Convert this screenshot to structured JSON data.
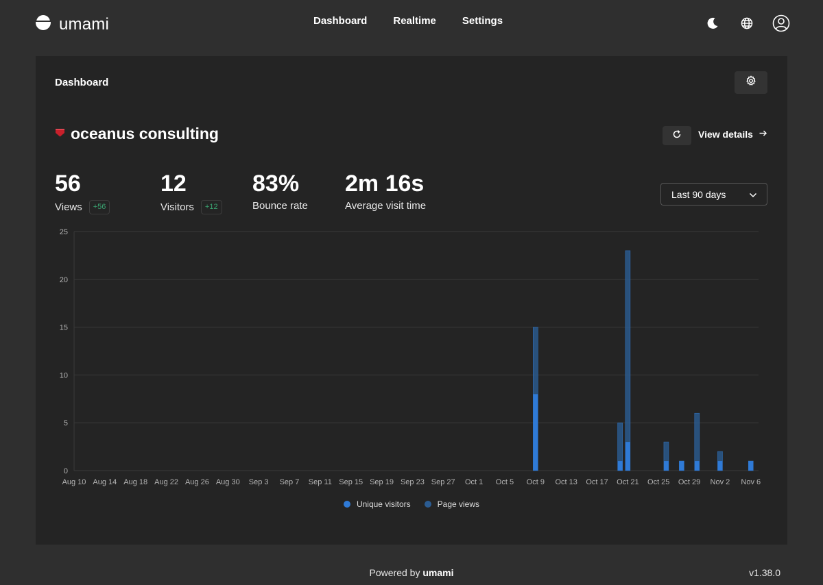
{
  "app": {
    "name": "umami",
    "version": "v1.38.0"
  },
  "nav": {
    "items": [
      "Dashboard",
      "Realtime",
      "Settings"
    ]
  },
  "header_icons": [
    "moon-icon",
    "globe-icon",
    "user-icon"
  ],
  "page": {
    "title": "Dashboard"
  },
  "website": {
    "name": "oceanus consulting",
    "view_details_label": "View details",
    "range_label": "Last 90 days"
  },
  "metrics": [
    {
      "value": "56",
      "label": "Views",
      "change": "+56"
    },
    {
      "value": "12",
      "label": "Visitors",
      "change": "+12"
    },
    {
      "value": "83%",
      "label": "Bounce rate",
      "change": ""
    },
    {
      "value": "2m 16s",
      "label": "Average visit time",
      "change": ""
    }
  ],
  "footer": {
    "powered_prefix": "Powered by",
    "powered_brand": "umami"
  },
  "colors": {
    "unique_visitors": "#2f7ad6",
    "page_views": "#2b5c92",
    "accent_badge": "#3aa371",
    "favicon": "#c8202b"
  },
  "chart_data": {
    "type": "bar",
    "xlabels": [
      "Aug 10",
      "Aug 14",
      "Aug 18",
      "Aug 22",
      "Aug 26",
      "Aug 30",
      "Sep 3",
      "Sep 7",
      "Sep 11",
      "Sep 15",
      "Sep 19",
      "Sep 23",
      "Sep 27",
      "Oct 1",
      "Oct 5",
      "Oct 9",
      "Oct 13",
      "Oct 17",
      "Oct 21",
      "Oct 25",
      "Oct 29",
      "Nov 2",
      "Nov 6"
    ],
    "x_start": "Aug 10",
    "x_end": "Nov 7",
    "ylim": [
      0,
      25
    ],
    "yticks": [
      0,
      5,
      10,
      15,
      20,
      25
    ],
    "grid": true,
    "legend_position": "bottom",
    "series": [
      {
        "name": "Unique visitors",
        "values": [
          {
            "x": "Oct 9",
            "y": 8
          },
          {
            "x": "Oct 20",
            "y": 1
          },
          {
            "x": "Oct 21",
            "y": 3
          },
          {
            "x": "Oct 26",
            "y": 1
          },
          {
            "x": "Oct 28",
            "y": 1
          },
          {
            "x": "Oct 30",
            "y": 1
          },
          {
            "x": "Nov 2",
            "y": 1
          },
          {
            "x": "Nov 6",
            "y": 1
          }
        ]
      },
      {
        "name": "Page views",
        "values": [
          {
            "x": "Oct 9",
            "y": 15
          },
          {
            "x": "Oct 20",
            "y": 5
          },
          {
            "x": "Oct 21",
            "y": 23
          },
          {
            "x": "Oct 26",
            "y": 3
          },
          {
            "x": "Oct 28",
            "y": 1
          },
          {
            "x": "Oct 30",
            "y": 6
          },
          {
            "x": "Nov 2",
            "y": 2
          },
          {
            "x": "Nov 6",
            "y": 1
          }
        ]
      }
    ]
  }
}
